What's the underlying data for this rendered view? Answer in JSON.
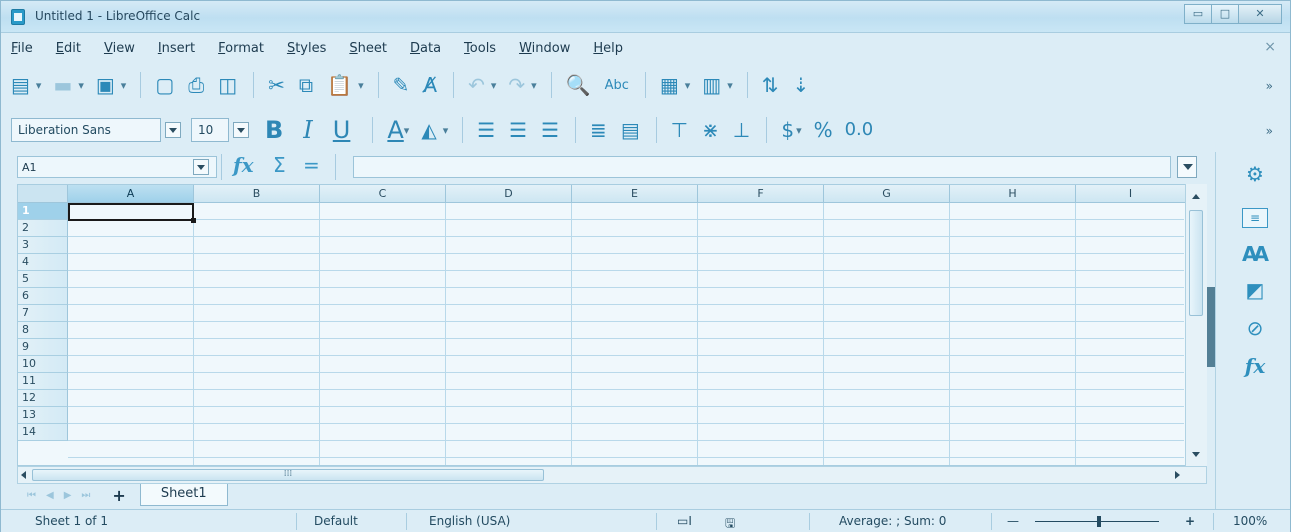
{
  "window": {
    "title": "Untitled 1 - LibreOffice Calc",
    "minimize": "▭",
    "maximize": "□",
    "close": "✕"
  },
  "menubar": {
    "items": [
      "File",
      "Edit",
      "View",
      "Insert",
      "Format",
      "Styles",
      "Sheet",
      "Data",
      "Tools",
      "Window",
      "Help"
    ],
    "close_doc": "×"
  },
  "toolbar": {
    "font_name": "Liberation Sans",
    "font_size": "10",
    "bold": "B",
    "italic": "I",
    "underline": "U",
    "font_color": "A",
    "currency": "$",
    "percent": "%",
    "decimal": "0.0",
    "spelling": "Abc",
    "overflow": "»"
  },
  "formula_bar": {
    "name_box": "A1",
    "function_wizard": "fx",
    "sum": "Σ",
    "equals": "=",
    "formula": ""
  },
  "grid": {
    "columns": [
      "A",
      "B",
      "C",
      "D",
      "E",
      "F",
      "G",
      "H",
      "I"
    ],
    "rows": [
      "1",
      "2",
      "3",
      "4",
      "5",
      "6",
      "7",
      "8",
      "9",
      "10",
      "11",
      "12",
      "13",
      "14"
    ],
    "selected_cell": "A1"
  },
  "hscroll": {
    "thumb_grip": "⁞⁞⁞"
  },
  "sheets": {
    "add": "+",
    "tabs": [
      "Sheet1"
    ]
  },
  "status": {
    "sheet_position": "Sheet 1 of 1",
    "page_style": "Default",
    "language": "English (USA)",
    "selection_mode": "▭I",
    "save_indicator": "🖫",
    "summary": "Average: ; Sum: 0",
    "zoom_out": "—",
    "zoom_in": "+",
    "zoom": "100%"
  },
  "colors": {
    "accent": "#2e8fbd",
    "window_bg": "#dcedf6",
    "grid_line": "#b9d9ea",
    "selected_header": "#9fd1ea"
  },
  "icons": {
    "sidebar": [
      "properties-icon",
      "styles-icon",
      "gallery-icon",
      "navigator-icon",
      "functions-icon",
      "settings-icon"
    ]
  }
}
